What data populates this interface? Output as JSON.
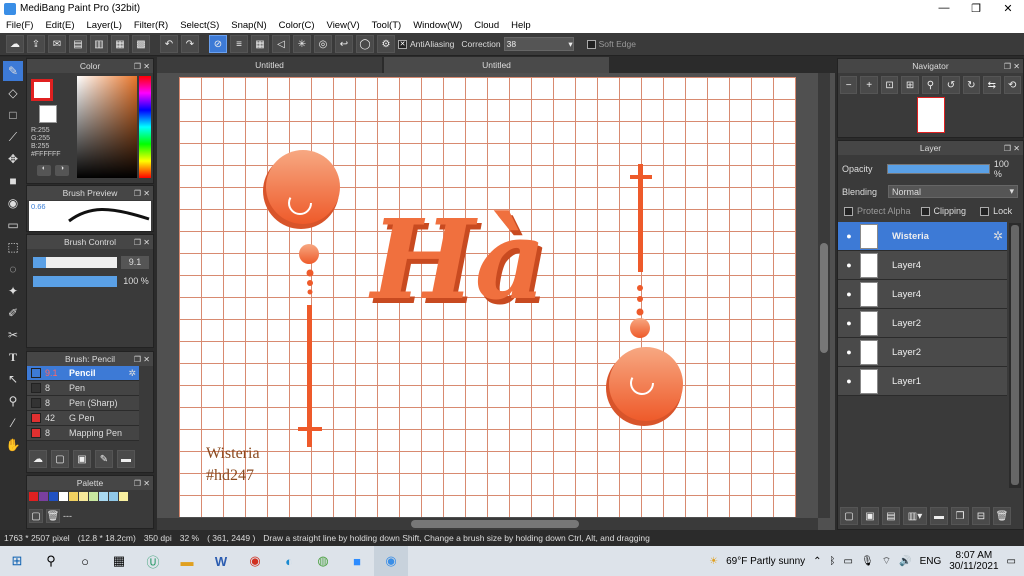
{
  "window": {
    "title": "MediBang Paint Pro (32bit)",
    "minimize": "—",
    "maximize": "❐",
    "close": "✕"
  },
  "menu": [
    "File(F)",
    "Edit(E)",
    "Layer(L)",
    "Filter(R)",
    "Select(S)",
    "Snap(N)",
    "Color(C)",
    "View(V)",
    "Tool(T)",
    "Window(W)",
    "Cloud",
    "Help"
  ],
  "toolbar": {
    "antialiasing_label": "AntiAliasing",
    "correction_label": "Correction",
    "correction_value": "38",
    "soft_edge_label": "Soft Edge"
  },
  "color_panel": {
    "title": "Color",
    "r": "R:255",
    "g": "G:255",
    "b": "B:255",
    "hex": "#FFFFFF"
  },
  "brush_preview": {
    "title": "Brush Preview",
    "size": "0.66"
  },
  "brush_control": {
    "title": "Brush Control",
    "size_value": "9.1",
    "opacity_value": "100 %"
  },
  "brush_list": {
    "title": "Brush: Pencil",
    "items": [
      {
        "size": "9.1",
        "name": "Pencil",
        "color": "#3d7ad6"
      },
      {
        "size": "8",
        "name": "Pen",
        "color": "#333333"
      },
      {
        "size": "8",
        "name": "Pen (Sharp)",
        "color": "#333333"
      },
      {
        "size": "42",
        "name": "G Pen",
        "color": "#e03030"
      },
      {
        "size": "8",
        "name": "Mapping Pen",
        "color": "#e03030"
      }
    ]
  },
  "palette": {
    "title": "Palette",
    "more": "---"
  },
  "tabs": [
    "Untitled",
    "Untitled"
  ],
  "canvas": {
    "lettering": "Hà",
    "watermark_line1": "Wisteria",
    "watermark_line2": "#hd247"
  },
  "navigator": {
    "title": "Navigator"
  },
  "layer_panel": {
    "title": "Layer",
    "opacity_label": "Opacity",
    "opacity_value": "100 %",
    "blending_label": "Blending",
    "blending_value": "Normal",
    "protect_alpha": "Protect Alpha",
    "clipping": "Clipping",
    "lock": "Lock",
    "layers": [
      "Wisteria",
      "Layer4",
      "Layer4",
      "Layer2",
      "Layer2",
      "Layer1"
    ]
  },
  "status": {
    "size": "1763 * 2507 pixel",
    "physical": "(12.8 * 18.2cm)",
    "dpi": "350 dpi",
    "zoom": "32 %",
    "coords": "( 361, 2449 )",
    "hint": "Draw a straight line by holding down Shift, Change a brush size by holding down Ctrl, Alt, and dragging"
  },
  "taskbar": {
    "weather": "69°F  Partly sunny",
    "lang": "ENG",
    "time": "8:07 AM",
    "date": "30/11/2021"
  }
}
